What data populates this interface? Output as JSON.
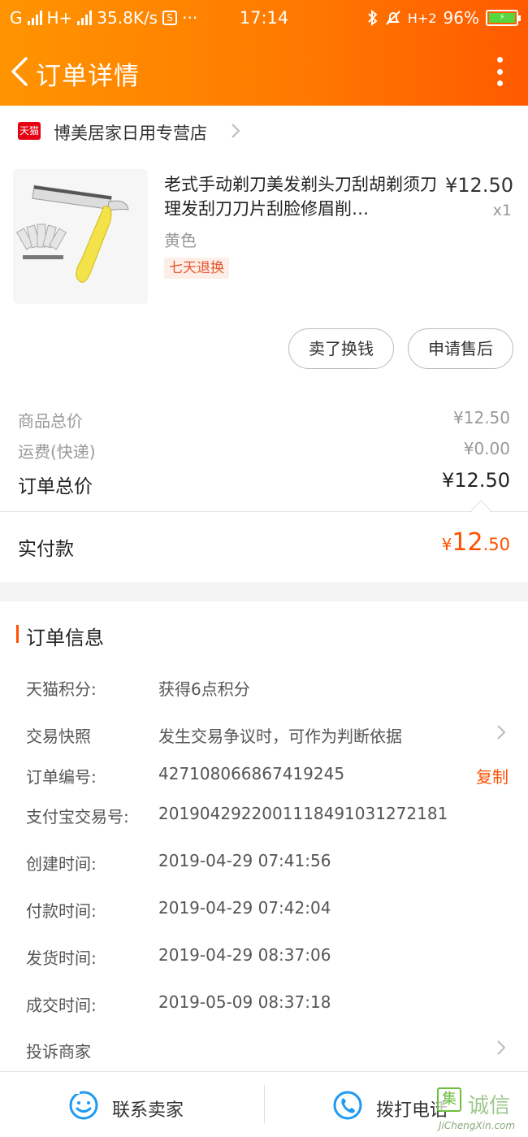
{
  "status_bar": {
    "carrier1": "G",
    "carrier2": "H+",
    "speed": "35.8K/s",
    "s_badge": "S",
    "dots": "···",
    "time": "17:14",
    "net3": "H+2",
    "battery": "96%"
  },
  "nav": {
    "title": "订单详情"
  },
  "shop": {
    "badge": "天猫",
    "name": "博美居家日用专营店"
  },
  "product": {
    "title": "老式手动剃刀美发剃头刀刮胡剃须刀理发刮刀刀片刮脸修眉削…",
    "price": "¥12.50",
    "quantity": "x1",
    "sku": "黄色",
    "tag": "七天退换"
  },
  "actions": {
    "sell_label": "卖了换钱",
    "after_sale_label": "申请售后"
  },
  "fees": {
    "goods_label": "商品总价",
    "goods_value": "¥12.50",
    "shipping_label": "运费(快递)",
    "shipping_value": "¥0.00",
    "total_label": "订单总价",
    "total_value": "¥12.50"
  },
  "payment": {
    "label": "实付款",
    "currency": "¥",
    "amount_int": "12",
    "amount_dec": ".50"
  },
  "order_info": {
    "section_title": "订单信息",
    "rows": [
      {
        "label": "天猫积分:",
        "value": "获得6点积分"
      },
      {
        "label": "交易快照",
        "value": "发生交易争议时，可作为判断依据"
      },
      {
        "label": "订单编号:",
        "value": "427108066867419245"
      },
      {
        "label": "支付宝交易号:",
        "value": "2019042922001118491031272181"
      },
      {
        "label": "创建时间:",
        "value": "2019-04-29 07:41:56"
      },
      {
        "label": "付款时间:",
        "value": "2019-04-29 07:42:04"
      },
      {
        "label": "发货时间:",
        "value": "2019-04-29 08:37:06"
      },
      {
        "label": "成交时间:",
        "value": "2019-05-09 08:37:18"
      },
      {
        "label": "投诉商家",
        "value": ""
      }
    ],
    "copy_label": "复制"
  },
  "bottom_bar": {
    "contact_seller": "联系卖家",
    "call_phone": "拨打电话"
  },
  "watermark": {
    "box": "集",
    "text": "诚信",
    "url": "JiChengXin.com"
  },
  "colors": {
    "accent": "#ff5000",
    "header_start": "#ff9400",
    "header_end": "#ff5a00",
    "tmall_red": "#e60012",
    "icon_blue": "#1e9af2"
  },
  "icons": {
    "back": "chevron-left-icon",
    "more": "vertical-dots-icon",
    "shop_arrow": "chevron-right-icon",
    "contact": "smile-chat-icon",
    "phone": "phone-icon"
  }
}
